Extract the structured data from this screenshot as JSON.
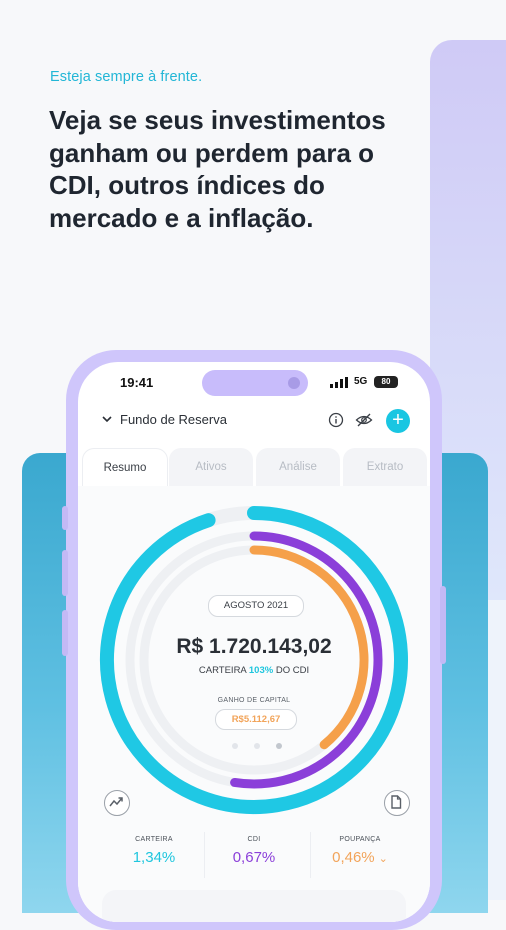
{
  "hero": {
    "tagline": "Esteja sempre à frente.",
    "headline": "Veja se seus investimentos ganham ou perdem para o CDI, outros índices do mercado e a inflação."
  },
  "status_bar": {
    "time": "19:41",
    "network": "5G",
    "battery": "80"
  },
  "header": {
    "fund_name": "Fundo de Reserva"
  },
  "tabs": [
    {
      "label": "Resumo",
      "active": true
    },
    {
      "label": "Ativos",
      "active": false
    },
    {
      "label": "Análise",
      "active": false
    },
    {
      "label": "Extrato",
      "active": false
    }
  ],
  "summary": {
    "period": "AGOSTO 2021",
    "total": "R$ 1.720.143,02",
    "carteira_prefix": "CARTEIRA",
    "carteira_pct": "103%",
    "carteira_suffix": "DO CDI",
    "gain_label": "GANHO DE CAPITAL",
    "gain_value": "R$5.112,67"
  },
  "chart_data": {
    "type": "ring",
    "series": [
      {
        "name": "CARTEIRA",
        "value": 1.34,
        "color": "#1fc8e4"
      },
      {
        "name": "CDI",
        "value": 0.67,
        "color": "#8b3fd9"
      },
      {
        "name": "POUPANÇA",
        "value": 0.46,
        "color": "#f5a04a"
      }
    ]
  },
  "stats": [
    {
      "label": "CARTEIRA",
      "value": "1,34%",
      "color": "#1fc6de"
    },
    {
      "label": "CDI",
      "value": "0,67%",
      "color": "#8b3fd9"
    },
    {
      "label": "POUPANÇA",
      "value": "0,46%",
      "color": "#f2a45a"
    }
  ],
  "icons": {
    "collapse": "chevron-down-icon",
    "info": "info-icon",
    "hide": "eye-off-icon",
    "add": "plus-icon",
    "trend": "trending-up-icon",
    "document": "document-icon",
    "stat_expand": "chevron-down-icon"
  }
}
